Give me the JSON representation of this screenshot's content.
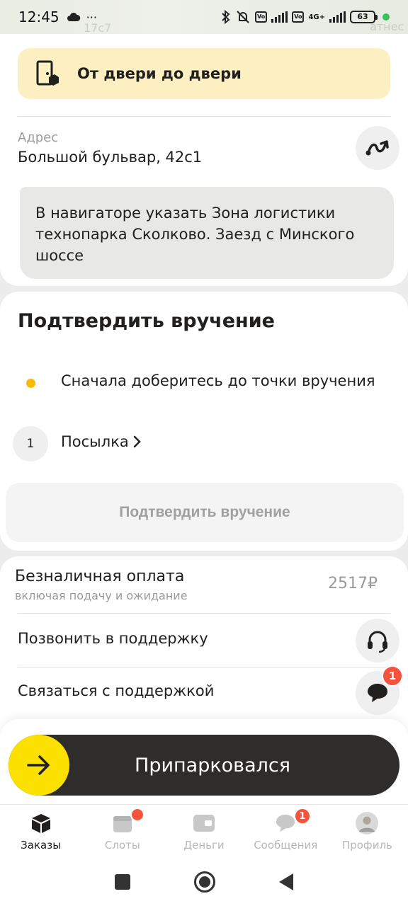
{
  "status_bar": {
    "time": "12:45",
    "overflow": "···",
    "battery": "63",
    "network": "4G+"
  },
  "map_labels": {
    "building": "17с7",
    "place": "атнес"
  },
  "delivery": {
    "type_label": "От двери до двери",
    "icon": "door-to-door-icon"
  },
  "address": {
    "caption": "Адрес",
    "value": "Большой бульвар, 42с1",
    "route_icon": "route-icon"
  },
  "comment": {
    "text": "В навигаторе указать Зона логистики технопарка Сколково. Заезд с Минского шоссе"
  },
  "confirm": {
    "title": "Подтвердить вручение",
    "step_text": "Сначала доберитесь до точки вручения",
    "parcel_count": "1",
    "parcel_label": "Посылка",
    "button_label": "Подтвердить вручение",
    "colors": {
      "step_dot": "#fcb900",
      "button_disabled_text": "#a0a0a0"
    }
  },
  "payment": {
    "title": "Безналичная оплата",
    "subtitle": "включая подачу и ожидание",
    "amount": "2517₽"
  },
  "support": {
    "call_label": "Позвонить в поддержку",
    "chat_label": "Связаться с поддержкой",
    "chat_badge": "1"
  },
  "action_slider": {
    "label": "Припарковался",
    "colors": {
      "track": "#2f2d2b",
      "knob": "#fce000"
    }
  },
  "tabs": [
    {
      "label": "Заказы",
      "icon": "orders-icon",
      "active": true
    },
    {
      "label": "Слоты",
      "icon": "calendar-icon",
      "badge": ""
    },
    {
      "label": "Деньги",
      "icon": "wallet-icon"
    },
    {
      "label": "Сообщения",
      "icon": "chat-icon",
      "badge": "1"
    },
    {
      "label": "Профиль",
      "icon": "avatar-icon"
    }
  ],
  "accent_colors": {
    "badge": "#f5533d",
    "highlight": "#fcefc2"
  }
}
